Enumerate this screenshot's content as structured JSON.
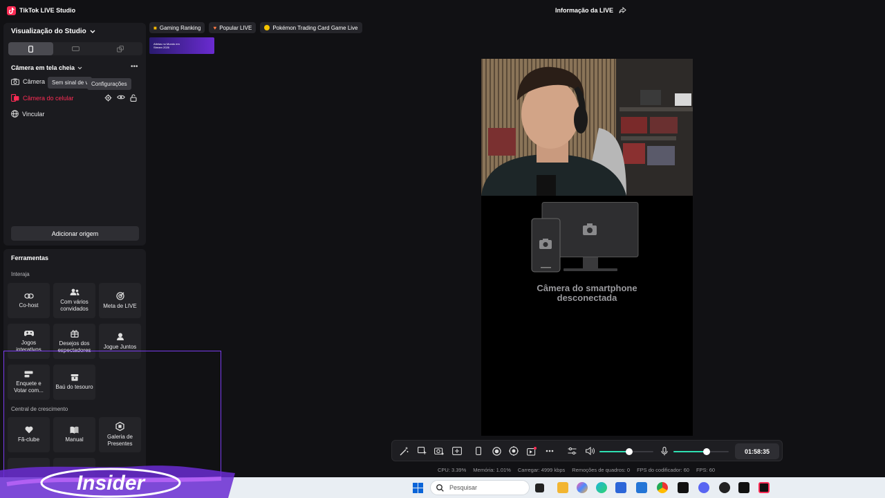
{
  "titlebar": {
    "app_title": "TikTok LIVE Studio",
    "live_info": "Informação da LIVE"
  },
  "sidebar": {
    "studio_title": "Visualização do Studio",
    "scene_title": "Câmera em tela cheia",
    "sources": [
      {
        "label": "Câmera",
        "icon": "camera-icon"
      },
      {
        "label": "Câmera do celular",
        "icon": "phone-camera-icon",
        "active": true
      },
      {
        "label": "Vincular",
        "icon": "globe-icon"
      }
    ],
    "tooltips": {
      "no_signal": "Sem sinal de v",
      "settings": "Configurações"
    },
    "add_source": "Adicionar origem"
  },
  "tools": {
    "title": "Ferramentas",
    "sections": {
      "interact": "Interaja",
      "growth": "Central de crescimento"
    },
    "interact_items": [
      {
        "label": "Co-host",
        "icon": "link-icon"
      },
      {
        "label": "Com vários convidados",
        "icon": "multi-guest-icon"
      },
      {
        "label": "Meta de LIVE",
        "icon": "target-icon"
      },
      {
        "label": "Jogos interativos",
        "icon": "gamepad-icon"
      },
      {
        "label": "Desejos dos espectadores",
        "icon": "gift-icon"
      },
      {
        "label": "Jogue Juntos",
        "icon": "play-together-icon"
      },
      {
        "label": "Enquete e Votar com...",
        "icon": "poll-icon"
      },
      {
        "label": "Baú do tesouro",
        "icon": "treasure-chest-icon"
      }
    ],
    "growth_items": [
      {
        "label": "Fã-clube",
        "icon": "heart-icon"
      },
      {
        "label": "Manual",
        "icon": "book-icon"
      },
      {
        "label": "Galeria de Presentes",
        "icon": "gift-gallery-icon"
      }
    ]
  },
  "chips": [
    {
      "label": "Gaming Ranking",
      "icon": "trophy-icon"
    },
    {
      "label": "Popular LIVE",
      "icon": "fire-icon"
    },
    {
      "label": "Pokémon Trading Card Game Live",
      "icon": "pokeball-icon"
    }
  ],
  "banner": {
    "text": "Atletas no Mundo em Stream 2026"
  },
  "preview": {
    "disconnected_line1": "Câmera do smartphone",
    "disconnected_line2": "desconectada"
  },
  "controls": {
    "timer": "01:58:35",
    "volume_level": 0.55,
    "mic_level": 0.6
  },
  "stats": {
    "cpu": "CPU: 3.39%",
    "memory": "Memória: 1.01%",
    "upload": "Carregar: 4999 kbps",
    "dropped": "Remoções de quadros: 0",
    "encoder_fps": "FPS do codificador: 60",
    "fps": "FPS: 60"
  },
  "taskbar": {
    "search_placeholder": "Pesquisar"
  },
  "overlay": {
    "logo_text": "Insider"
  },
  "colors": {
    "accent": "#fe2c55",
    "mint": "#2fe0b3",
    "highlight": "#7b3cf0"
  }
}
